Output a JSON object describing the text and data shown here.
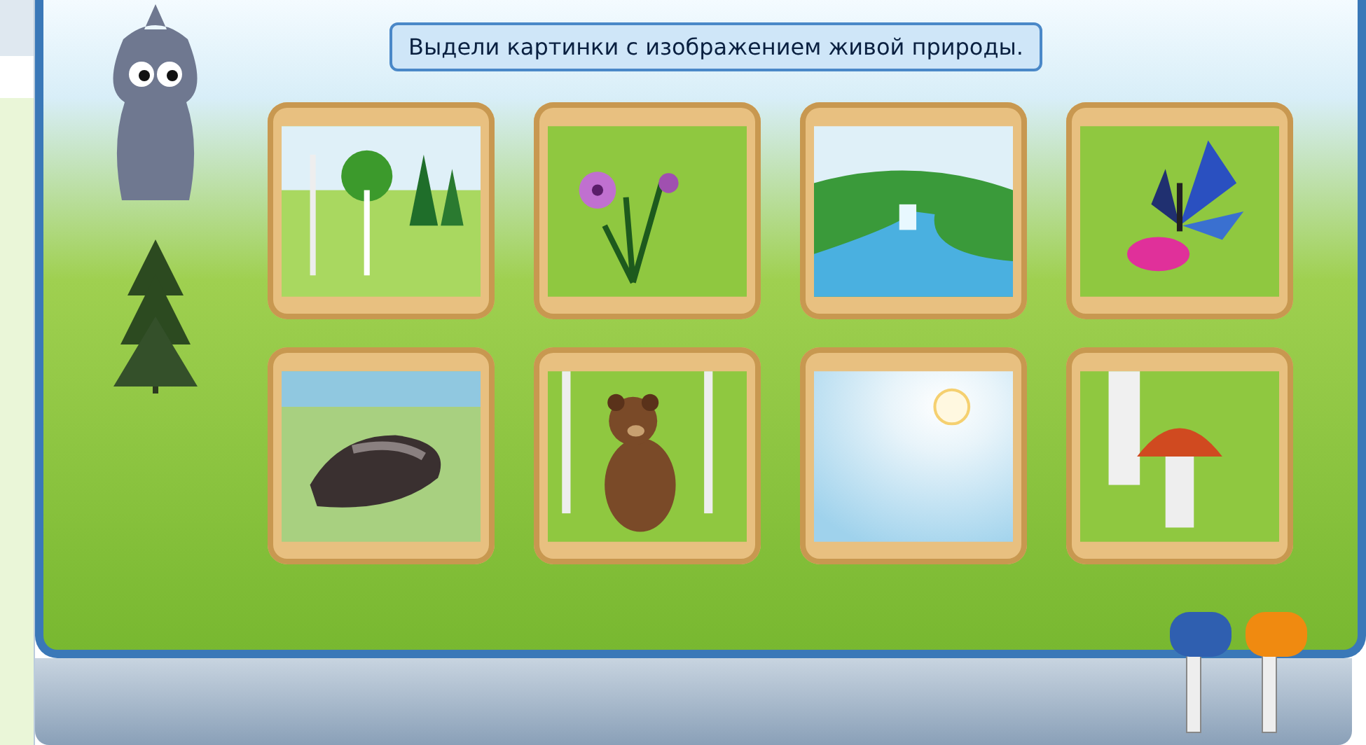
{
  "instruction": "Выдели картинки с изображением живой природы.",
  "cards": [
    {
      "kind": "forest",
      "selected": false
    },
    {
      "kind": "flower",
      "selected": false
    },
    {
      "kind": "river",
      "selected": false
    },
    {
      "kind": "butterfly",
      "selected": false
    },
    {
      "kind": "stone",
      "selected": false
    },
    {
      "kind": "bear",
      "selected": false
    },
    {
      "kind": "sun",
      "selected": false
    },
    {
      "kind": "mushroom",
      "selected": false
    }
  ],
  "levers": [
    {
      "color": "#2f5fb0"
    },
    {
      "color": "#f08a10"
    }
  ]
}
